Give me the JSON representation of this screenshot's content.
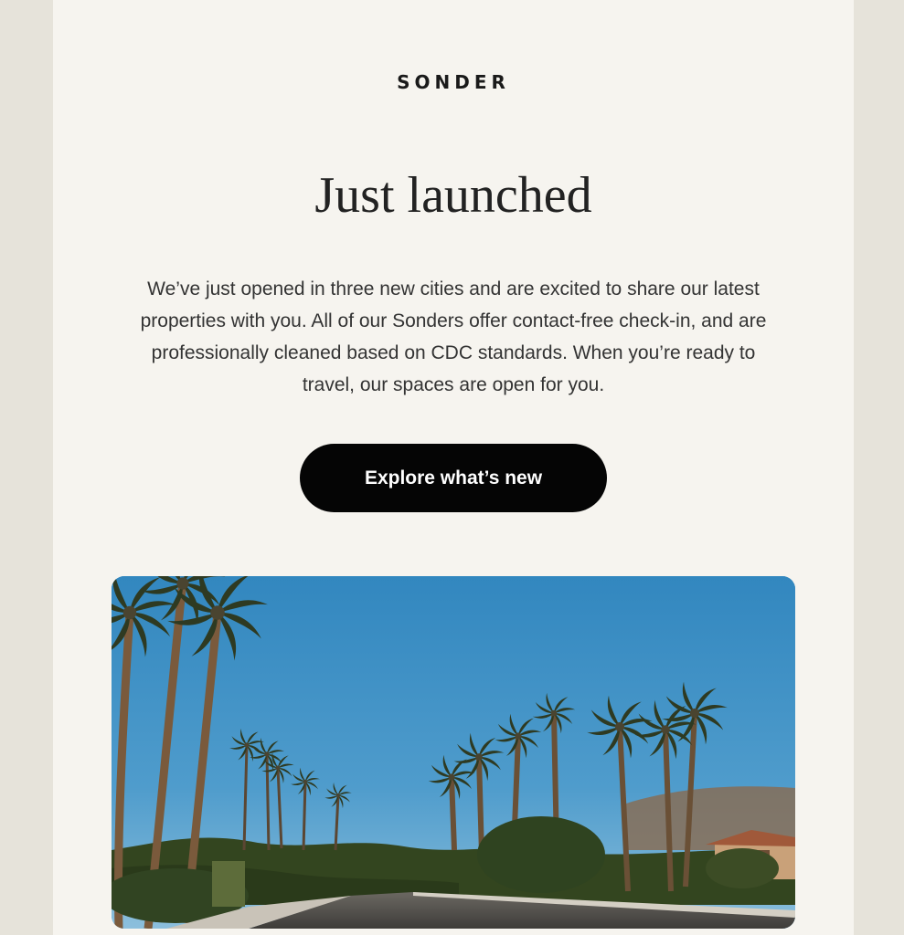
{
  "email": {
    "brand": "SONDER",
    "headline": "Just launched",
    "body": "We’ve just opened in three new cities and are excited to share our latest properties with you. All of our Sonders offer contact-free check-in, and are professionally cleaned based on CDC standards. When you’re ready to travel, our spaces are open for you.",
    "cta_label": "Explore what’s new",
    "hero_image": "palm-tree-lined-street-photo"
  },
  "colors": {
    "page_background": "#e6e3da",
    "card_background": "#f6f4ef",
    "button": "#050505",
    "button_text": "#ffffff",
    "sky": "#3f8fc3"
  }
}
